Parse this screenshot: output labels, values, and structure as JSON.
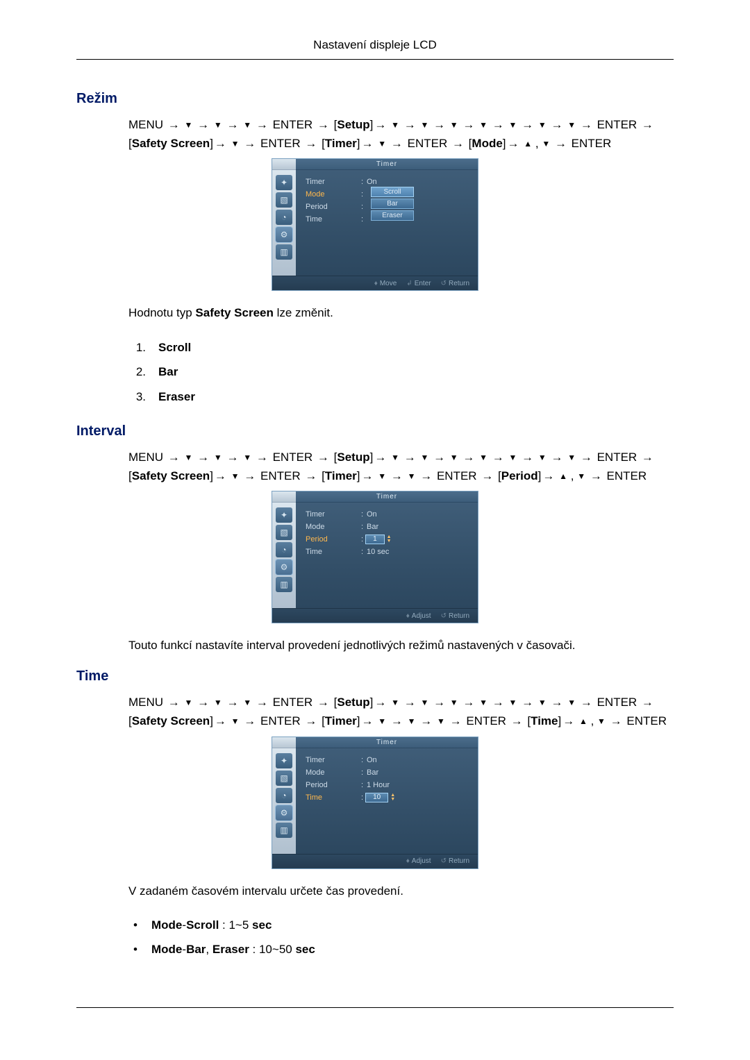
{
  "page_header": "Nastavení displeje LCD",
  "glyphs": {
    "arrow": "→",
    "tri_down": "▼",
    "tri_up": "▲",
    "dot": "•"
  },
  "osd_common": {
    "title": "Timer",
    "labels": {
      "timer": "Timer",
      "mode": "Mode",
      "period": "Period",
      "time": "Time"
    },
    "icons": [
      "✦",
      "▧",
      "◔",
      "⚙",
      "▥"
    ]
  },
  "sections": {
    "rezim": {
      "title": "Režim",
      "path_tokens": [
        {
          "t": "text",
          "v": "MENU"
        },
        {
          "t": "arr"
        },
        {
          "t": "dn"
        },
        {
          "t": "arr"
        },
        {
          "t": "dn"
        },
        {
          "t": "arr"
        },
        {
          "t": "dn"
        },
        {
          "t": "arr"
        },
        {
          "t": "text",
          "v": "ENTER"
        },
        {
          "t": "arr"
        },
        {
          "t": "br",
          "v": "Setup"
        },
        {
          "t": "arr"
        },
        {
          "t": "dn"
        },
        {
          "t": "arr"
        },
        {
          "t": "dn"
        },
        {
          "t": "arr"
        },
        {
          "t": "dn"
        },
        {
          "t": "arr"
        },
        {
          "t": "dn"
        },
        {
          "t": "arr"
        },
        {
          "t": "dn"
        },
        {
          "t": "arr"
        },
        {
          "t": "dn"
        },
        {
          "t": "arr"
        },
        {
          "t": "dn"
        },
        {
          "t": "arr"
        },
        {
          "t": "text",
          "v": "ENTER"
        },
        {
          "t": "arr"
        },
        {
          "t": "br",
          "v": "Safety Screen"
        },
        {
          "t": "arr"
        },
        {
          "t": "dn"
        },
        {
          "t": "arr"
        },
        {
          "t": "text",
          "v": "ENTER"
        },
        {
          "t": "arr"
        },
        {
          "t": "br",
          "v": "Timer"
        },
        {
          "t": "arr"
        },
        {
          "t": "dn"
        },
        {
          "t": "arr"
        },
        {
          "t": "text",
          "v": "ENTER"
        },
        {
          "t": "arr"
        },
        {
          "t": "br",
          "v": "Mode"
        },
        {
          "t": "arr"
        },
        {
          "t": "up"
        },
        {
          "t": "text",
          "v": ","
        },
        {
          "t": "dn"
        },
        {
          "t": "arr"
        },
        {
          "t": "text",
          "v": "ENTER"
        }
      ],
      "osd": {
        "rows": [
          {
            "label": "Timer",
            "value": "On",
            "active": false
          },
          {
            "label": "Mode",
            "value": "",
            "active": true
          },
          {
            "label": "Period",
            "value": "",
            "active": false
          },
          {
            "label": "Time",
            "value": "",
            "active": false
          }
        ],
        "picks": [
          "Scroll",
          "Bar",
          "Eraser"
        ],
        "pick_hl": 0,
        "footer": [
          {
            "icon": "♦",
            "label": "Move"
          },
          {
            "icon": "↲",
            "label": "Enter"
          },
          {
            "icon": "↺",
            "label": "Return"
          }
        ]
      },
      "body_pre": "Hodnotu typ ",
      "body_bold": "Safety Screen",
      "body_post": " lze změnit.",
      "list": [
        "Scroll",
        "Bar",
        "Eraser"
      ]
    },
    "interval": {
      "title": "Interval",
      "path_tokens": [
        {
          "t": "text",
          "v": "MENU"
        },
        {
          "t": "arr"
        },
        {
          "t": "dn"
        },
        {
          "t": "arr"
        },
        {
          "t": "dn"
        },
        {
          "t": "arr"
        },
        {
          "t": "dn"
        },
        {
          "t": "arr"
        },
        {
          "t": "text",
          "v": "ENTER"
        },
        {
          "t": "arr"
        },
        {
          "t": "br",
          "v": "Setup"
        },
        {
          "t": "arr"
        },
        {
          "t": "dn"
        },
        {
          "t": "arr"
        },
        {
          "t": "dn"
        },
        {
          "t": "arr"
        },
        {
          "t": "dn"
        },
        {
          "t": "arr"
        },
        {
          "t": "dn"
        },
        {
          "t": "arr"
        },
        {
          "t": "dn"
        },
        {
          "t": "arr"
        },
        {
          "t": "dn"
        },
        {
          "t": "arr"
        },
        {
          "t": "dn"
        },
        {
          "t": "arr"
        },
        {
          "t": "text",
          "v": "ENTER"
        },
        {
          "t": "arr"
        },
        {
          "t": "br",
          "v": "Safety Screen"
        },
        {
          "t": "arr"
        },
        {
          "t": "dn"
        },
        {
          "t": "arr"
        },
        {
          "t": "text",
          "v": "ENTER"
        },
        {
          "t": "arr"
        },
        {
          "t": "br",
          "v": "Timer"
        },
        {
          "t": "arr"
        },
        {
          "t": "dn"
        },
        {
          "t": "arr"
        },
        {
          "t": "dn"
        },
        {
          "t": "arr"
        },
        {
          "t": "text",
          "v": "ENTER"
        },
        {
          "t": "arr"
        },
        {
          "t": "br",
          "v": "Period"
        },
        {
          "t": "arr"
        },
        {
          "t": "up"
        },
        {
          "t": "text",
          "v": ","
        },
        {
          "t": "dn"
        },
        {
          "t": "arr"
        },
        {
          "t": "text",
          "v": "ENTER"
        }
      ],
      "osd": {
        "rows": [
          {
            "label": "Timer",
            "value": "On",
            "active": false
          },
          {
            "label": "Mode",
            "value": "Bar",
            "active": false
          },
          {
            "label": "Period",
            "value": "",
            "active": true,
            "numbox": "1"
          },
          {
            "label": "Time",
            "value": "10 sec",
            "active": false
          }
        ],
        "footer": [
          {
            "icon": "♦",
            "label": "Adjust"
          },
          {
            "icon": "↺",
            "label": "Return"
          }
        ]
      },
      "body": "Touto funkcí nastavíte interval provedení jednotlivých režimů nastavených v časovači."
    },
    "time": {
      "title": "Time",
      "path_tokens": [
        {
          "t": "text",
          "v": "MENU"
        },
        {
          "t": "arr"
        },
        {
          "t": "dn"
        },
        {
          "t": "arr"
        },
        {
          "t": "dn"
        },
        {
          "t": "arr"
        },
        {
          "t": "dn"
        },
        {
          "t": "arr"
        },
        {
          "t": "text",
          "v": "ENTER"
        },
        {
          "t": "arr"
        },
        {
          "t": "br",
          "v": "Setup"
        },
        {
          "t": "arr"
        },
        {
          "t": "dn"
        },
        {
          "t": "arr"
        },
        {
          "t": "dn"
        },
        {
          "t": "arr"
        },
        {
          "t": "dn"
        },
        {
          "t": "arr"
        },
        {
          "t": "dn"
        },
        {
          "t": "arr"
        },
        {
          "t": "dn"
        },
        {
          "t": "arr"
        },
        {
          "t": "dn"
        },
        {
          "t": "arr"
        },
        {
          "t": "dn"
        },
        {
          "t": "arr"
        },
        {
          "t": "text",
          "v": "ENTER"
        },
        {
          "t": "arr"
        },
        {
          "t": "br",
          "v": "Safety Screen"
        },
        {
          "t": "arr"
        },
        {
          "t": "dn"
        },
        {
          "t": "arr"
        },
        {
          "t": "text",
          "v": "ENTER"
        },
        {
          "t": "arr"
        },
        {
          "t": "br",
          "v": "Timer"
        },
        {
          "t": "arr"
        },
        {
          "t": "dn"
        },
        {
          "t": "arr"
        },
        {
          "t": "dn"
        },
        {
          "t": "arr"
        },
        {
          "t": "dn"
        },
        {
          "t": "arr"
        },
        {
          "t": "text",
          "v": "ENTER"
        },
        {
          "t": "arr"
        },
        {
          "t": "br",
          "v": "Time"
        },
        {
          "t": "arr"
        },
        {
          "t": "up"
        },
        {
          "t": "text",
          "v": ","
        },
        {
          "t": "dn"
        },
        {
          "t": "arr"
        },
        {
          "t": "text",
          "v": "ENTER"
        }
      ],
      "osd": {
        "rows": [
          {
            "label": "Timer",
            "value": "On",
            "active": false
          },
          {
            "label": "Mode",
            "value": "Bar",
            "active": false
          },
          {
            "label": "Period",
            "value": "1 Hour",
            "active": false
          },
          {
            "label": "Time",
            "value": "",
            "active": true,
            "numbox": "10"
          }
        ],
        "footer": [
          {
            "icon": "♦",
            "label": "Adjust"
          },
          {
            "icon": "↺",
            "label": "Return"
          }
        ]
      },
      "body": "V zadaném časovém intervalu určete čas provedení.",
      "bullets": [
        {
          "pre": "Mode",
          "mid": "-",
          "b2": "Scroll",
          "post": " : 1~5 ",
          "tail": "sec"
        },
        {
          "pre": "Mode",
          "mid": "-",
          "b2": "Bar",
          "post": ", ",
          "b3": "Eraser",
          "post2": " : 10~50 ",
          "tail": "sec"
        }
      ]
    }
  }
}
